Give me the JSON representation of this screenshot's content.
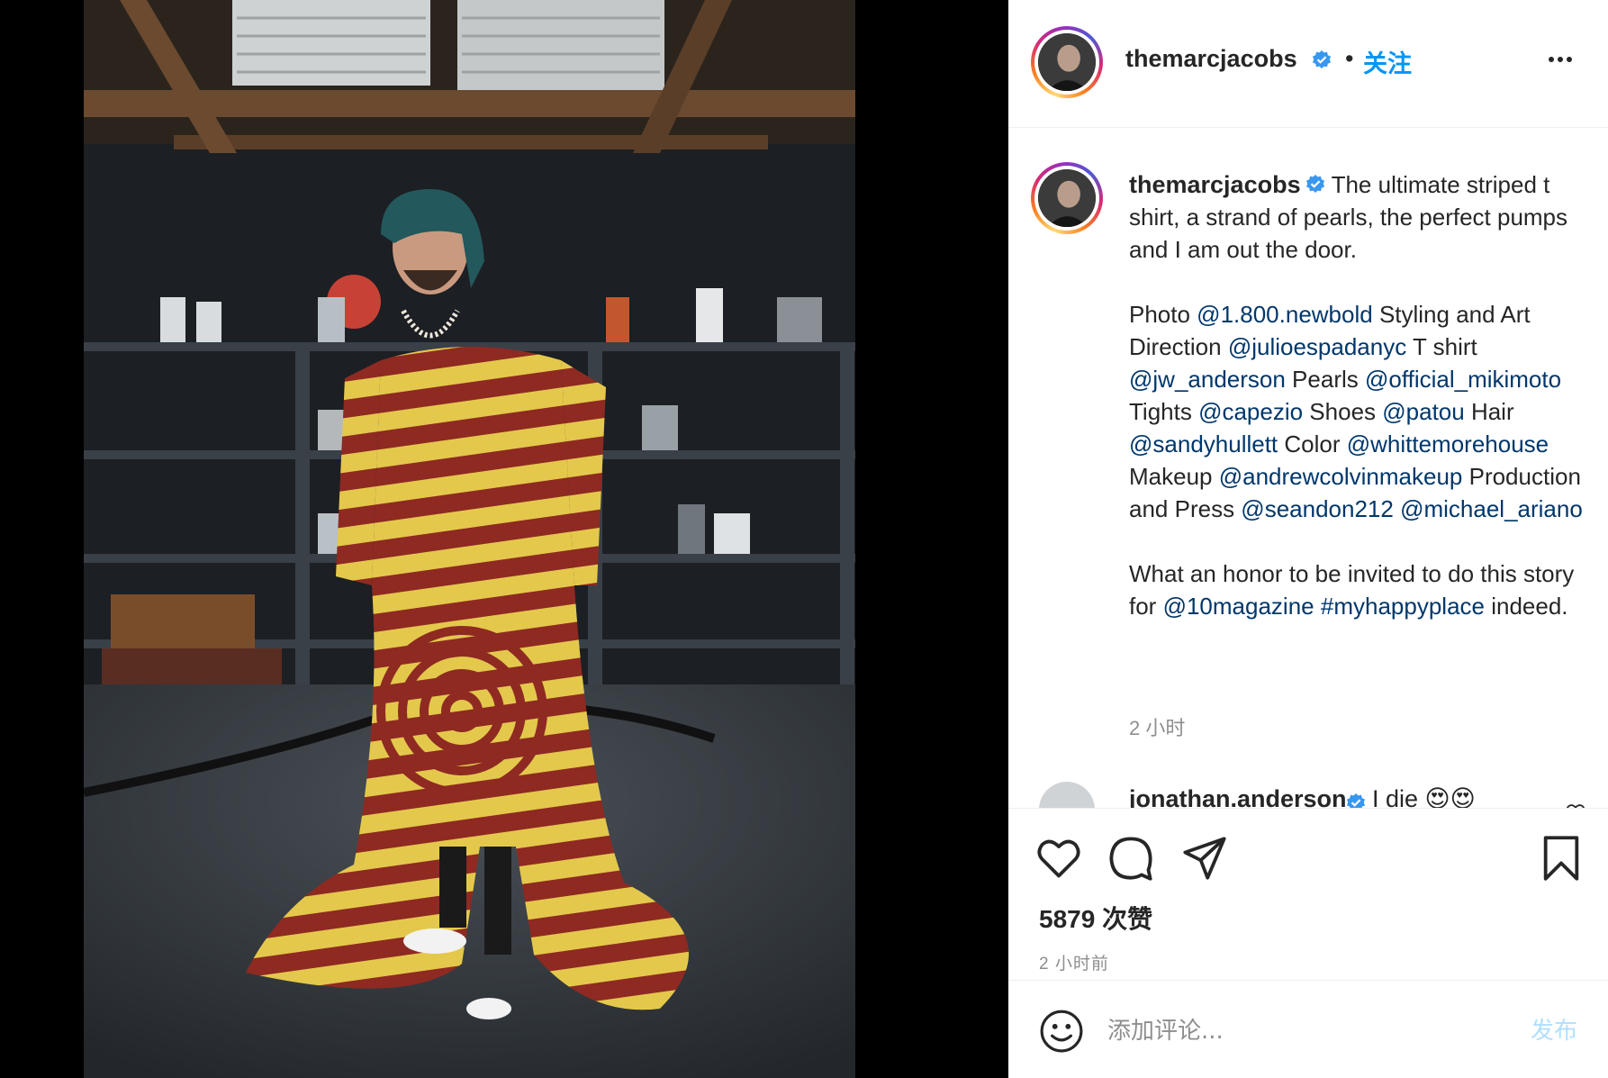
{
  "post": {
    "username": "themarcjacobs",
    "follow_label": "关注",
    "dot": "•",
    "caption": {
      "intro": "The ultimate striped t shirt, a strand of pearls, the perfect pumps and I am out the door.",
      "credits": [
        {
          "t": "Photo ",
          "m": false
        },
        {
          "t": "@1.800.newbold",
          "m": true
        },
        {
          "t": " Styling and Art Direction ",
          "m": false
        },
        {
          "t": "@julioespadanyc",
          "m": true
        },
        {
          "t": " T shirt ",
          "m": false
        },
        {
          "t": "@jw_anderson",
          "m": true
        },
        {
          "t": " Pearls ",
          "m": false
        },
        {
          "t": "@official_mikimoto",
          "m": true
        },
        {
          "t": " Tights ",
          "m": false
        },
        {
          "t": "@capezio",
          "m": true
        },
        {
          "t": " Shoes ",
          "m": false
        },
        {
          "t": "@patou",
          "m": true
        },
        {
          "t": " Hair ",
          "m": false
        },
        {
          "t": "@sandyhullett",
          "m": true
        },
        {
          "t": " Color ",
          "m": false
        },
        {
          "t": "@whittemorehouse",
          "m": true
        },
        {
          "t": " Makeup ",
          "m": false
        },
        {
          "t": "@andrewcolvinmakeup",
          "m": true
        },
        {
          "t": " Production and Press ",
          "m": false
        },
        {
          "t": "@seandon212",
          "m": true
        },
        {
          "t": " ",
          "m": false
        },
        {
          "t": "@michael_ariano",
          "m": true
        }
      ],
      "outro_parts": [
        {
          "t": "What an honor to be invited to do this story for ",
          "m": false
        },
        {
          "t": "@10magazine",
          "m": true
        },
        {
          "t": " ",
          "m": false
        },
        {
          "t": "#myhappyplace",
          "m": true
        },
        {
          "t": " indeed.",
          "m": false
        }
      ],
      "time": "2 小时"
    },
    "next_comment": {
      "username": "jonathan.anderson",
      "text": "I die 😍😍"
    },
    "likes": "5879 次赞",
    "time": "2 小时前",
    "comment_box": {
      "placeholder": "添加评论...",
      "post_label": "发布"
    }
  },
  "colors": {
    "accent": "#0095f6",
    "mention": "#00376b",
    "muted": "#8e8e8e",
    "verified": "#3897f0",
    "post_disabled": "#b2dffc"
  },
  "icons": [
    "heart-icon",
    "comment-icon",
    "share-icon",
    "bookmark-icon",
    "more-icon",
    "emoji-icon",
    "verified-badge-icon"
  ]
}
